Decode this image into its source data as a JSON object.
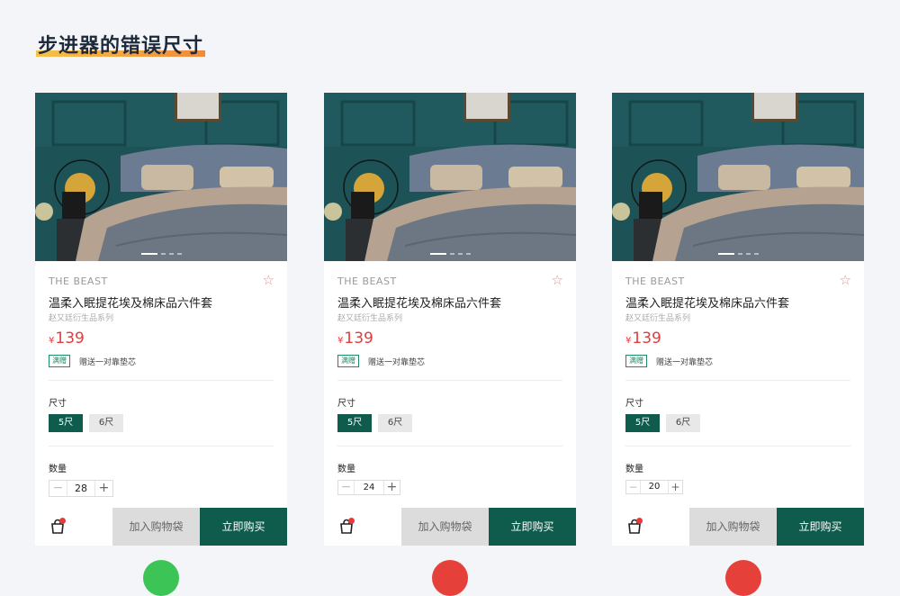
{
  "page": {
    "title": "步进器的错误尺寸"
  },
  "product": {
    "brand": "THE BEAST",
    "name": "温柔入眠提花埃及棉床品六件套",
    "series": "赵又廷衍生品系列",
    "currency": "¥",
    "price": "139",
    "promo_tag": "满赠",
    "promo_text": "赠送一对靠垫芯",
    "size_label": "尺寸",
    "sizes": [
      "5尺",
      "6尺"
    ],
    "selected_size": "5尺",
    "qty_label": "数量",
    "add_to_bag": "加入购物袋",
    "buy_now": "立即购买"
  },
  "cards": [
    {
      "quantity": "28",
      "verdict": "correct"
    },
    {
      "quantity": "24",
      "verdict": "wrong"
    },
    {
      "quantity": "20",
      "verdict": "wrong"
    }
  ],
  "colors": {
    "accent": "#0f5b4c",
    "price": "#e23c3c",
    "correct": "#3cc556",
    "wrong": "#e5413a"
  }
}
